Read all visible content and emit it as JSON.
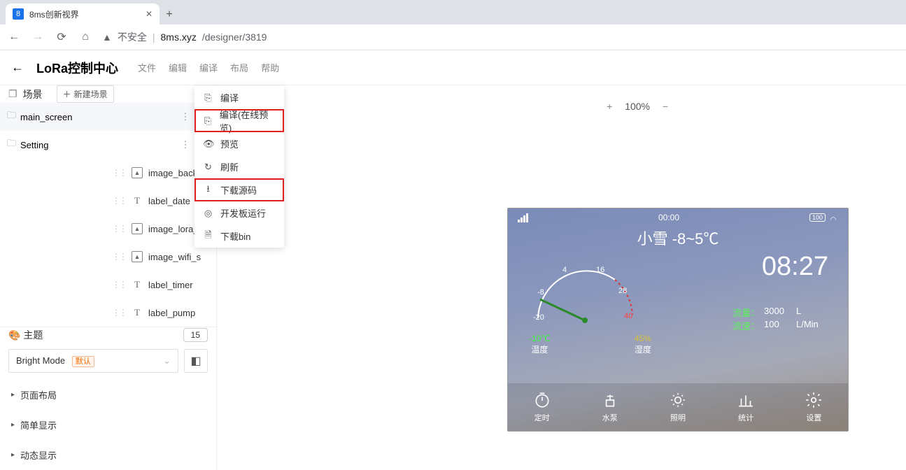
{
  "browser": {
    "tab_title": "8ms创新视界",
    "url_prefix": "不安全",
    "url_host": "8ms.xyz",
    "url_path": "/designer/3819"
  },
  "app": {
    "title": "LoRa控制中心",
    "menus": [
      "文件",
      "编辑",
      "编译",
      "布局",
      "帮助"
    ]
  },
  "compile_menu": {
    "items": [
      "编译",
      "编译(在线预览)",
      "预览",
      "刷新",
      "下载源码",
      "开发板运行",
      "下载bin"
    ]
  },
  "scene": {
    "header": "场景",
    "new_btn": "新建场景",
    "items": [
      "main_screen",
      "Setting"
    ]
  },
  "components": {
    "items": [
      {
        "type": "image",
        "label": "image_back"
      },
      {
        "type": "text",
        "label": "label_date"
      },
      {
        "type": "image",
        "label": "image_lora_"
      },
      {
        "type": "image",
        "label": "image_wifi_s"
      },
      {
        "type": "text",
        "label": "label_timer"
      },
      {
        "type": "text",
        "label": "label_pump"
      }
    ]
  },
  "theme": {
    "label": "主题",
    "count": "15",
    "mode": "Bright Mode",
    "default_tag": "默认"
  },
  "sections": [
    "页面布局",
    "简单显示",
    "动态显示"
  ],
  "toolbar": {
    "zoom": "100%"
  },
  "device": {
    "status_time": "00:00",
    "battery": "100",
    "weather": "小雪 -8~5℃",
    "time": "08:27",
    "gauge_ticks": {
      "min": "-20",
      "a": "-8",
      "b": "4",
      "c": "16",
      "d": "28",
      "max": "40"
    },
    "temp": {
      "val": "-10℃",
      "lab": "温度"
    },
    "hum": {
      "val": "45%",
      "lab": "湿度"
    },
    "flow": {
      "label": "流量：",
      "val": "3000",
      "unit": "L"
    },
    "speed": {
      "label": "流速：",
      "val": "100",
      "unit": "L/Min"
    },
    "tabs": [
      "定时",
      "水泵",
      "照明",
      "统计",
      "设置"
    ]
  }
}
